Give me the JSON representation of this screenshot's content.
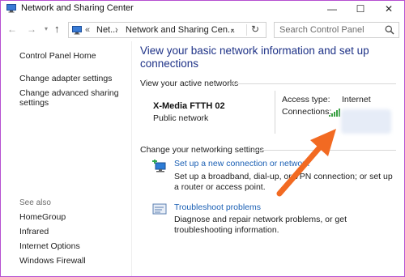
{
  "window": {
    "title": "Network and Sharing Center",
    "controls": {
      "minimize": "—",
      "maximize": "☐",
      "close": "✕"
    }
  },
  "nav": {
    "back": "←",
    "forward": "→",
    "recent": "▾",
    "up": "↑",
    "breadcrumb": {
      "overflow": "«",
      "item1": "Net...",
      "separator": "›",
      "item2": "Network and Sharing Cen...",
      "dropdown": "▾"
    },
    "refresh": "↻",
    "search_placeholder": "Search Control Panel"
  },
  "sidebar": {
    "home": "Control Panel Home",
    "links": [
      "Change adapter settings",
      "Change advanced sharing settings"
    ],
    "see_also_label": "See also",
    "see_also": [
      "HomeGroup",
      "Infrared",
      "Internet Options",
      "Windows Firewall"
    ]
  },
  "main": {
    "title": "View your basic network information and set up connections",
    "active_networks_heading": "View your active networks",
    "network": {
      "name": "X-Media FTTH 02",
      "type": "Public network",
      "access_type_label": "Access type:",
      "access_type_value": "Internet",
      "connections_label": "Connections:"
    },
    "change_heading": "Change your networking settings",
    "tasks": [
      {
        "title": "Set up a new connection or network",
        "description": "Set up a broadband, dial-up, or VPN connection; or set up a router or access point."
      },
      {
        "title": "Troubleshoot problems",
        "description": "Diagnose and repair network problems, or get troubleshooting information."
      }
    ]
  },
  "colors": {
    "window_border": "#b54fd0",
    "title_blue": "#1e3287",
    "link_blue": "#1a5fb4",
    "annotation_arrow": "#f26a22"
  }
}
